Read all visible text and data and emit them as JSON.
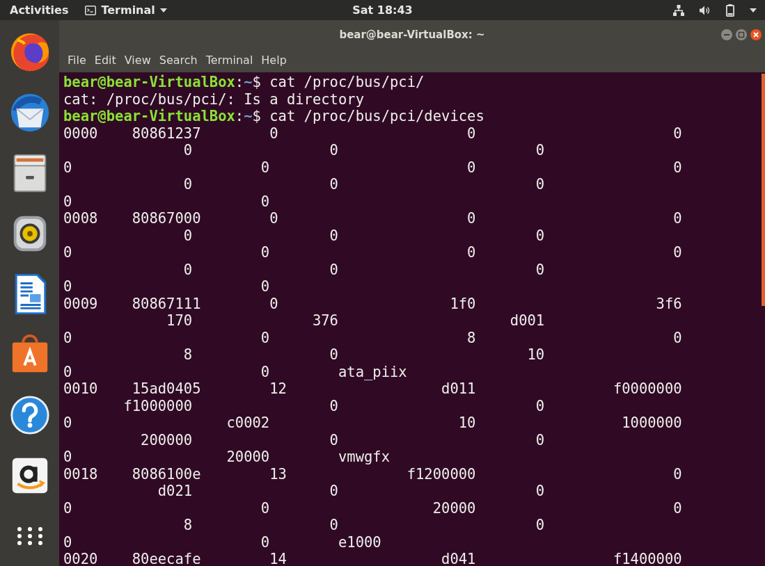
{
  "top_bar": {
    "activities": "Activities",
    "app_menu": "Terminal",
    "clock": "Sat 18:43"
  },
  "dock": {
    "items": [
      {
        "kind": "browser"
      },
      {
        "kind": "mail"
      },
      {
        "kind": "files"
      },
      {
        "kind": "music"
      },
      {
        "kind": "writer"
      },
      {
        "kind": "store"
      },
      {
        "kind": "help"
      },
      {
        "kind": "shop"
      },
      {
        "kind": "apps"
      }
    ]
  },
  "window": {
    "title": "bear@bear-VirtualBox: ~",
    "menu": [
      "File",
      "Edit",
      "View",
      "Search",
      "Terminal",
      "Help"
    ],
    "lines": [
      {
        "kind": "prompt",
        "user_host": "bear@bear-VirtualBox",
        "separator": ":",
        "path": "~",
        "symbol": "$",
        "command": "cat /proc/bus/pci/"
      },
      {
        "kind": "output",
        "text": "cat: /proc/bus/pci/: Is a directory"
      },
      {
        "kind": "prompt",
        "user_host": "bear@bear-VirtualBox",
        "separator": ":",
        "path": "~",
        "symbol": "$",
        "command": "cat /proc/bus/pci/devices"
      },
      {
        "kind": "output",
        "text": "0000    80861237        0                      0                       0"
      },
      {
        "kind": "output",
        "text": "              0                0                       0"
      },
      {
        "kind": "output",
        "text": "0                      0                       0                       0"
      },
      {
        "kind": "output",
        "text": "              0                0                       0"
      },
      {
        "kind": "output",
        "text": "0                      0"
      },
      {
        "kind": "output",
        "text": "0008    80867000        0                      0                       0"
      },
      {
        "kind": "output",
        "text": "              0                0                       0"
      },
      {
        "kind": "output",
        "text": "0                      0                       0                       0"
      },
      {
        "kind": "output",
        "text": "              0                0                       0"
      },
      {
        "kind": "output",
        "text": "0                      0"
      },
      {
        "kind": "output",
        "text": "0009    80867111        0                    1f0                     3f6"
      },
      {
        "kind": "output",
        "text": "            170              376                    d001"
      },
      {
        "kind": "output",
        "text": "0                      0                       8                       0"
      },
      {
        "kind": "output",
        "text": "              8                0                      10"
      },
      {
        "kind": "output",
        "text": "0                      0        ata_piix"
      },
      {
        "kind": "output",
        "text": "0010    15ad0405        12                  d011                f0000000"
      },
      {
        "kind": "output",
        "text": "       f1000000                0                       0"
      },
      {
        "kind": "output",
        "text": "0                  c0002                      10                 1000000"
      },
      {
        "kind": "output",
        "text": "         200000                0                       0"
      },
      {
        "kind": "output",
        "text": "0                  20000        vmwgfx"
      },
      {
        "kind": "output",
        "text": "0018    8086100e        13              f1200000                       0"
      },
      {
        "kind": "output",
        "text": "           d021                0                       0"
      },
      {
        "kind": "output",
        "text": "0                      0                   20000                       0"
      },
      {
        "kind": "output",
        "text": "              8                0                       0"
      },
      {
        "kind": "output",
        "text": "0                      0        e1000"
      },
      {
        "kind": "output",
        "text": "0020    80eecafe        14                  d041                f1400000"
      }
    ]
  }
}
